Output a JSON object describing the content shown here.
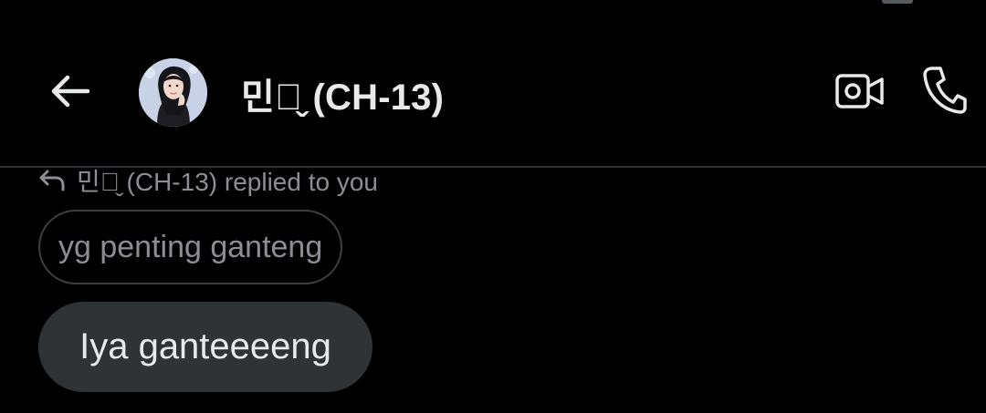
{
  "header": {
    "back_icon": "arrow-left-icon",
    "avatar_icon": "profile-photo",
    "title": "민주̬ (CH-13)",
    "video_call_icon": "video-camera-icon",
    "voice_call_icon": "phone-icon"
  },
  "reply": {
    "icon": "reply-arrow-icon",
    "context_text": "민주̬ (CH-13) replied to you",
    "quoted_message": "yg penting ganteng"
  },
  "message": {
    "text": "Iya ganteeeeng"
  },
  "colors": {
    "background": "#000000",
    "primary_text": "#e7e9ea",
    "secondary_text": "#8b8f94",
    "bubble": "#2f3336",
    "divider": "#2f3336"
  }
}
